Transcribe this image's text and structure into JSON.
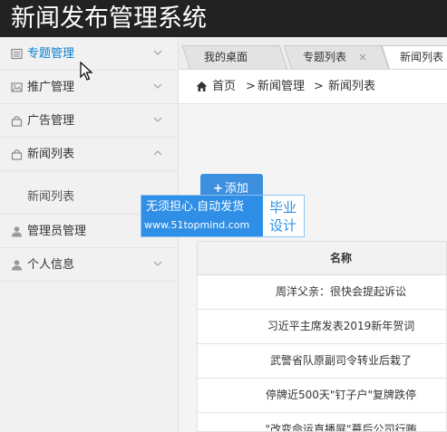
{
  "app": {
    "title": "新闻发布管理系统"
  },
  "sidebar": {
    "items": [
      {
        "label": "专题管理",
        "icon": "list-icon",
        "active": true
      },
      {
        "label": "推广管理",
        "icon": "image-icon"
      },
      {
        "label": "广告管理",
        "icon": "bag-icon"
      },
      {
        "label": "新闻列表",
        "icon": "bag-icon",
        "expanded": true
      },
      {
        "label": "管理员管理",
        "icon": "user-icon"
      },
      {
        "label": "个人信息",
        "icon": "user-icon"
      }
    ],
    "subitems": [
      {
        "label": "新闻列表"
      }
    ]
  },
  "tabs": [
    {
      "label": "我的桌面"
    },
    {
      "label": "专题列表",
      "close": "×"
    },
    {
      "label": "新闻列表",
      "active": true
    }
  ],
  "breadcrumb": {
    "home": "首页",
    "sep": ">",
    "level1": "新闻管理",
    "level2": "新闻列表"
  },
  "toolbar": {
    "add_plus": "+",
    "add_label": "添加"
  },
  "watermark": {
    "line1": "无须担心.自动发货",
    "line2": "www.51topmind.com",
    "right1": "毕业",
    "right2": "设计"
  },
  "table": {
    "header": "名称",
    "rows": [
      "周洋父亲：很快会提起诉讼",
      "习近平主席发表2019新年贺词",
      "武警省队原副司令转业后栽了",
      "停牌近500天\"钉子户\"复牌跌停",
      "\"改变命运直播屏\"幕后公司行贿"
    ]
  },
  "colors": {
    "accent": "#0a7fd0",
    "button": "#3d8fdf",
    "topbar": "#222222",
    "sidebar": "#f1f1f1"
  }
}
